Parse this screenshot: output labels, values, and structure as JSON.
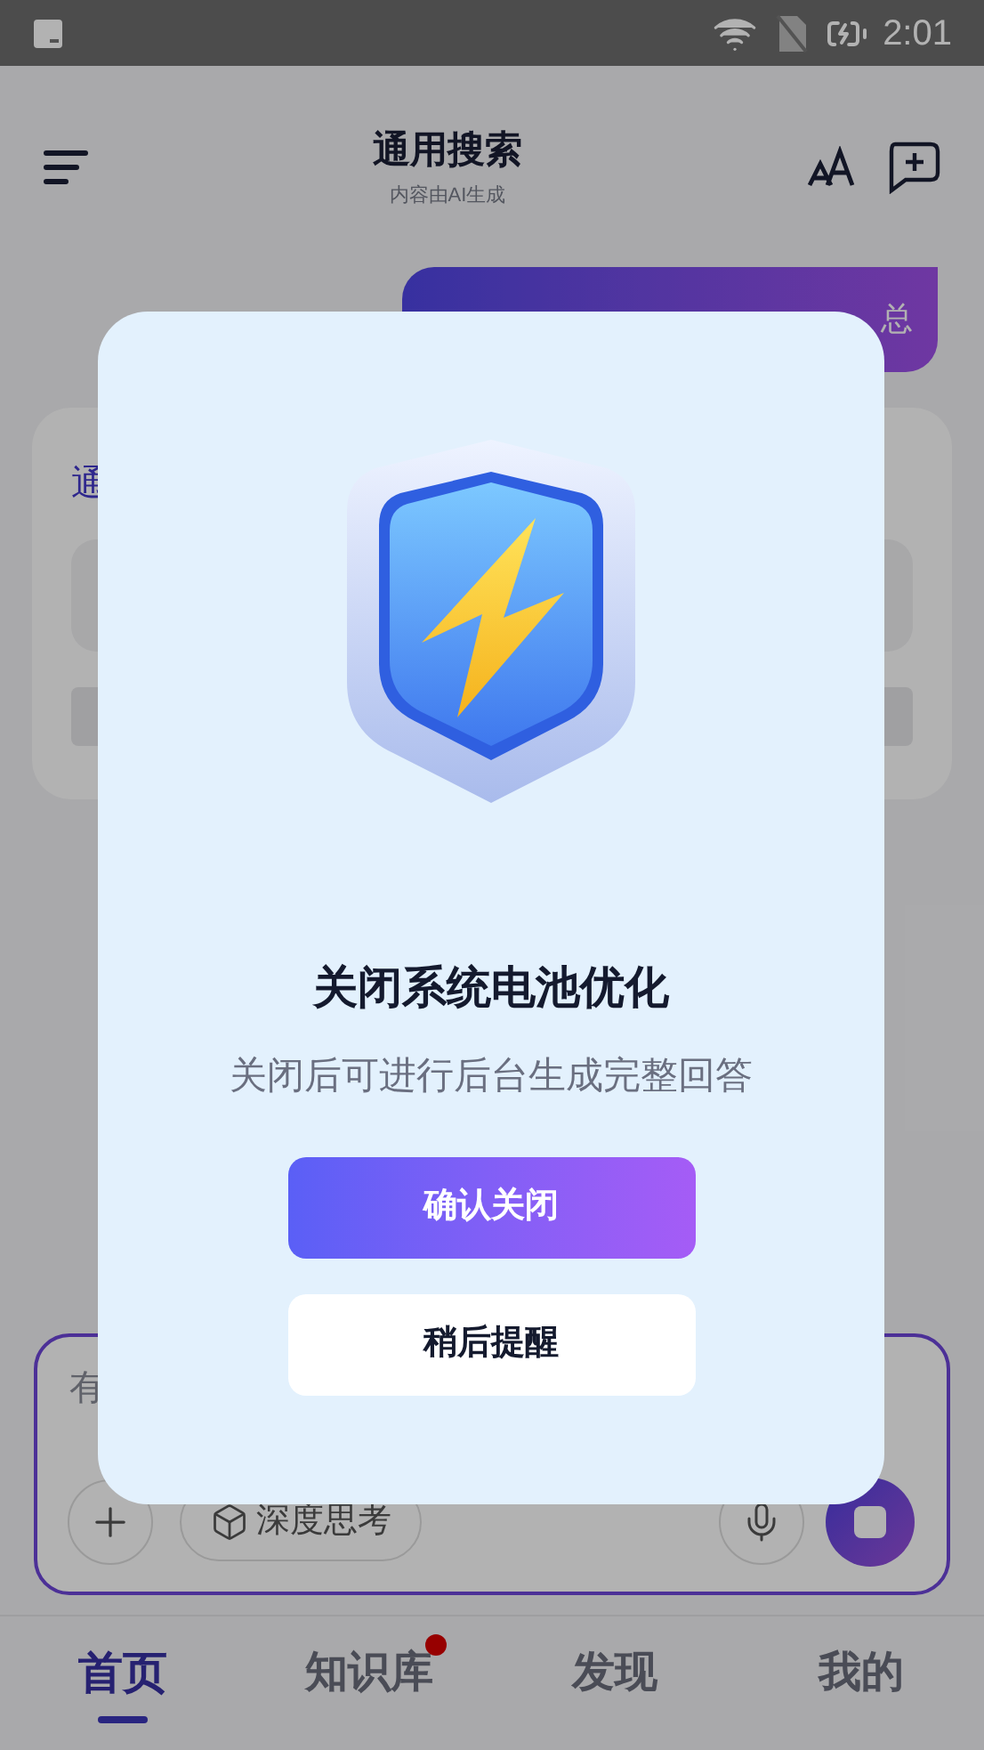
{
  "status_bar": {
    "time": "2:01"
  },
  "header": {
    "title": "通用搜索",
    "subtitle": "内容由AI生成"
  },
  "chat": {
    "user_message": "总",
    "card_text": "通"
  },
  "composer": {
    "placeholder": "有",
    "deep_think": "深度思考"
  },
  "bottom_nav": [
    {
      "label": "首页",
      "selected": true,
      "badge": false
    },
    {
      "label": "知识库",
      "selected": false,
      "badge": true
    },
    {
      "label": "发现",
      "selected": false,
      "badge": false
    },
    {
      "label": "我的",
      "selected": false,
      "badge": false
    }
  ],
  "dialog": {
    "title": "关闭系统电池优化",
    "message": "关闭后可进行后台生成完整回答",
    "buttons": [
      {
        "label": "确认关闭",
        "kind": "primary"
      },
      {
        "label": "稍后提醒",
        "kind": "secondary"
      }
    ]
  }
}
